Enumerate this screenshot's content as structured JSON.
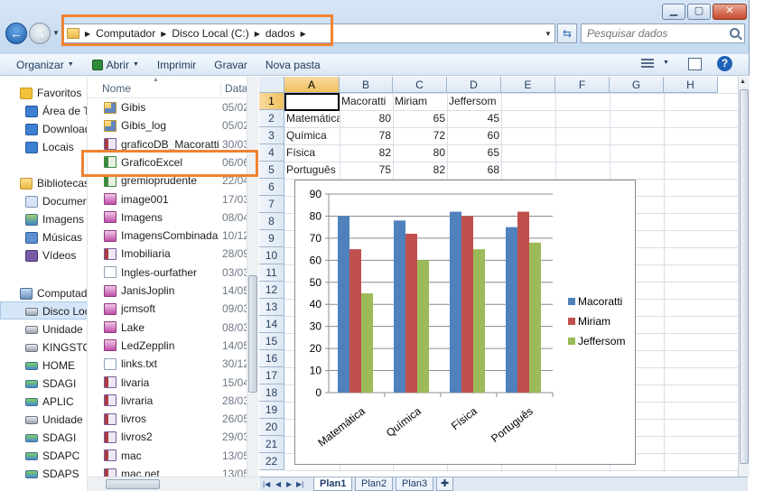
{
  "window": {
    "min_label": "▁",
    "max_label": "▢",
    "close_label": "✕"
  },
  "address": {
    "crumbs": [
      "Computador",
      "Disco Local (C:)",
      "dados"
    ],
    "search_placeholder": "Pesquisar dados"
  },
  "toolbar": {
    "organize": "Organizar",
    "open": "Abrir",
    "print": "Imprimir",
    "burn": "Gravar",
    "new_folder": "Nova pasta",
    "help": "?"
  },
  "navpane": {
    "items": [
      {
        "label": "Favoritos",
        "icon": "star-icon"
      },
      {
        "label": "Área de Trabalho",
        "icon": "desktop-icon"
      },
      {
        "label": "Downloads",
        "icon": "downloads-icon"
      },
      {
        "label": "Locais",
        "icon": "recent-places-icon"
      },
      {
        "label": "Bibliotecas",
        "icon": "libraries-icon"
      },
      {
        "label": "Documentos",
        "icon": "documents-icon"
      },
      {
        "label": "Imagens",
        "icon": "pictures-icon"
      },
      {
        "label": "Músicas",
        "icon": "music-icon"
      },
      {
        "label": "Vídeos",
        "icon": "videos-icon"
      },
      {
        "label": "Computador",
        "icon": "computer-icon"
      },
      {
        "label": "Disco Local (C:)",
        "icon": "drive-icon"
      },
      {
        "label": "Unidade",
        "icon": "drive-icon"
      },
      {
        "label": "KINGSTON",
        "icon": "usb-drive-icon"
      },
      {
        "label": "HOME",
        "icon": "network-drive-icon"
      },
      {
        "label": "SDAGI",
        "icon": "network-drive-icon"
      },
      {
        "label": "APLIC",
        "icon": "network-drive-icon"
      },
      {
        "label": "Unidade",
        "icon": "drive-icon"
      },
      {
        "label": "SDAGI",
        "icon": "network-drive-icon"
      },
      {
        "label": "SDAPC",
        "icon": "network-drive-icon"
      },
      {
        "label": "SDAPS",
        "icon": "network-drive-icon"
      }
    ]
  },
  "filelist": {
    "col_name": "Nome",
    "col_date": "Data",
    "files": [
      {
        "name": "Gibis",
        "date": "05/02",
        "icon": "folder-icon"
      },
      {
        "name": "Gibis_log",
        "date": "05/02",
        "icon": "folder-icon"
      },
      {
        "name": "graficoDB_Macoratti",
        "date": "30/03",
        "icon": "access-db-icon"
      },
      {
        "name": "GraficoExcel",
        "date": "06/06",
        "icon": "excel-file-icon"
      },
      {
        "name": "gremioprudente",
        "date": "22/04",
        "icon": "excel-file-icon"
      },
      {
        "name": "image001",
        "date": "17/03",
        "icon": "image-file-icon"
      },
      {
        "name": "Imagens",
        "date": "08/04",
        "icon": "image-file-icon"
      },
      {
        "name": "ImagensCombinadas",
        "date": "10/12",
        "icon": "image-file-icon"
      },
      {
        "name": "Imobiliaria",
        "date": "28/09",
        "icon": "access-db-icon"
      },
      {
        "name": "Ingles-ourfather",
        "date": "03/03",
        "icon": "text-file-icon"
      },
      {
        "name": "JanisJoplin",
        "date": "14/05",
        "icon": "image-file-icon"
      },
      {
        "name": "jcmsoft",
        "date": "09/03",
        "icon": "image-file-icon"
      },
      {
        "name": "Lake",
        "date": "08/03",
        "icon": "image-file-icon"
      },
      {
        "name": "LedZepplin",
        "date": "14/05",
        "icon": "image-file-icon"
      },
      {
        "name": "links.txt",
        "date": "30/12",
        "icon": "text-file-icon"
      },
      {
        "name": "livaria",
        "date": "15/04",
        "icon": "access-db-icon"
      },
      {
        "name": "livraria",
        "date": "28/03",
        "icon": "access-db-icon"
      },
      {
        "name": "livros",
        "date": "26/05",
        "icon": "access-db-icon"
      },
      {
        "name": "livros2",
        "date": "29/03",
        "icon": "access-db-icon"
      },
      {
        "name": "mac",
        "date": "13/05",
        "icon": "access-db-icon"
      },
      {
        "name": "mac.net",
        "date": "13/05",
        "icon": "access-db-icon"
      }
    ]
  },
  "sheet": {
    "columns": [
      "A",
      "B",
      "C",
      "D",
      "E",
      "F",
      "G",
      "H"
    ],
    "rows": [
      "1",
      "2",
      "3",
      "4",
      "5",
      "6",
      "7",
      "8",
      "9",
      "10",
      "11",
      "12",
      "13",
      "14",
      "15",
      "16",
      "17",
      "18",
      "19",
      "20",
      "21",
      "22"
    ],
    "cells": {
      "B1": "Macoratti",
      "C1": "Miriam",
      "D1": "Jeffersom",
      "A2": "Matemática",
      "B2": "80",
      "C2": "65",
      "D2": "45",
      "A3": "Química",
      "B3": "78",
      "C3": "72",
      "D3": "60",
      "A4": "Física",
      "B4": "82",
      "C4": "80",
      "D4": "65",
      "A5": "Português",
      "B5": "75",
      "C5": "82",
      "D5": "68"
    },
    "tabs": [
      "Plan1",
      "Plan2",
      "Plan3"
    ]
  },
  "chart_data": {
    "type": "bar",
    "categories": [
      "Matemática",
      "Química",
      "Física",
      "Português"
    ],
    "series": [
      {
        "name": "Macoratti",
        "values": [
          80,
          78,
          82,
          75
        ],
        "color": "#4f81bd"
      },
      {
        "name": "Miriam",
        "values": [
          65,
          72,
          80,
          82
        ],
        "color": "#c0504d"
      },
      {
        "name": "Jeffersom",
        "values": [
          45,
          60,
          65,
          68
        ],
        "color": "#9bbb59"
      }
    ],
    "title": "",
    "xlabel": "",
    "ylabel": "",
    "ylim": [
      0,
      90
    ],
    "yticks": [
      0,
      10,
      20,
      30,
      40,
      50,
      60,
      70,
      80,
      90
    ],
    "grid": true,
    "legend": "right"
  },
  "colors": {
    "highlight": "#f08330"
  }
}
